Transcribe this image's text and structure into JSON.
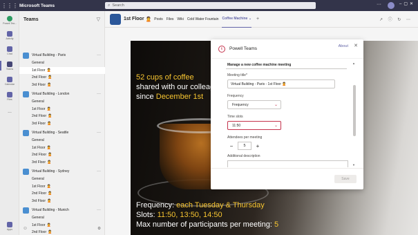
{
  "app": {
    "title": "Microsoft Teams"
  },
  "search": {
    "placeholder": "Search"
  },
  "rail": [
    {
      "label": "Powell Tea...",
      "icon": "powell-icon"
    },
    {
      "label": "Activity",
      "icon": "bell-icon"
    },
    {
      "label": "Chat",
      "icon": "chat-icon"
    },
    {
      "label": "Teams",
      "icon": "teams-icon",
      "active": true
    },
    {
      "label": "Calendar",
      "icon": "calendar-icon"
    },
    {
      "label": "Files",
      "icon": "files-icon"
    },
    {
      "label": "...",
      "icon": "more-icon"
    },
    {
      "label": "Apps",
      "icon": "apps-icon"
    }
  ],
  "teams_panel": {
    "title": "Teams",
    "teams": [
      {
        "name": "Virtual Building - Paris",
        "channels": [
          "General",
          "1st Floor",
          "2nd Floor",
          "3rd Floor"
        ]
      },
      {
        "name": "Virtual Building - London",
        "channels": [
          "General",
          "1st Floor",
          "2nd Floor",
          "3rd Floor"
        ]
      },
      {
        "name": "Virtual Building - Seattle",
        "channels": [
          "General",
          "1st Floor",
          "2nd Floor",
          "3rd Floor"
        ]
      },
      {
        "name": "Virtual Building - Sydney",
        "channels": [
          "General",
          "1st Floor",
          "2nd Floor",
          "3rd Floor"
        ]
      },
      {
        "name": "Virtual Building - Munich",
        "channels": [
          "General",
          "1st Floor",
          "2nd Floor",
          "3rd Floor"
        ]
      }
    ]
  },
  "channel": {
    "name": "1st Floor",
    "emoji": "🙎",
    "tabs": [
      "Posts",
      "Files",
      "Wiki",
      "Cold Water Fountain",
      "Coffee Machine"
    ],
    "active_tab": "Coffee Machine"
  },
  "hero": {
    "line1": "52 cups of coffee",
    "line2": "shared with our colleag",
    "line3_a": "since ",
    "line3_b": "December 1st",
    "freq_a": "Frequency: ",
    "freq_b": "each Tuesday & Thursday",
    "slots_a": "Slots: ",
    "slots_b": "11:50, 13:50, 14:50",
    "max_a": "Max number of participants per meeting: ",
    "max_b": "5"
  },
  "modal": {
    "title": "Powell Teams",
    "logo_letter": "t",
    "about": "About",
    "section": "Manage a new coffee machine meeting",
    "meeting_title_label": "Meeting title*",
    "meeting_title_value": "Virtual Building - Paris - 1st Floor 🙎",
    "frequency_label": "Frequency",
    "frequency_value": "Frequency",
    "timeslots_label": "Time slots",
    "timeslots_value": "11:50",
    "attendees_label": "Attendees per meeting",
    "attendees_value": "5",
    "description_label": "Additional description",
    "save_label": "Save"
  },
  "colors": {
    "accent": "#6264a7",
    "highlight": "#f7c531",
    "error": "#c4314b",
    "topbar": "#33344a"
  }
}
